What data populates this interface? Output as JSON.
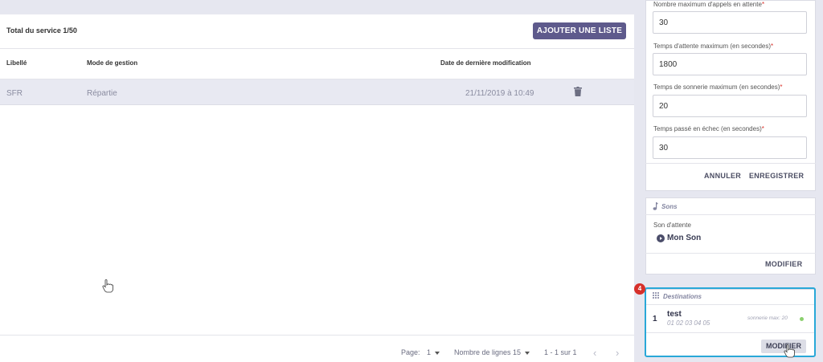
{
  "left": {
    "total_label": "Total du service 1/50",
    "add_button": "AJOUTER UNE LISTE",
    "columns": {
      "libelle": "Libellé",
      "mode": "Mode de gestion",
      "date": "Date de dernière modification"
    },
    "rows": [
      {
        "libelle": "SFR",
        "mode": "Répartie",
        "date": "21/11/2019 à 10:49"
      }
    ],
    "pager": {
      "page_label": "Page:",
      "page_value": "1",
      "lines_label": "Nombre de lignes",
      "lines_value": "15",
      "range": "1 - 1 sur 1"
    }
  },
  "settings": {
    "fields": [
      {
        "label": "Nombre maximum d'appels en attente",
        "value": "30"
      },
      {
        "label": "Temps d'attente maximum (en secondes)",
        "value": "1800"
      },
      {
        "label": "Temps de sonnerie maximum (en secondes)",
        "value": "20"
      },
      {
        "label": "Temps passé en échec (en secondes)",
        "value": "30"
      }
    ],
    "required_mark": "*",
    "cancel": "ANNULER",
    "save": "ENREGISTRER"
  },
  "sons": {
    "title": "Sons",
    "field_label": "Son d'attente",
    "value": "Mon Son",
    "modify": "MODIFIER"
  },
  "destinations": {
    "title": "Destinations",
    "badge": "4",
    "items": [
      {
        "index": "1",
        "name": "test",
        "number": "01 02 03 04 05",
        "ring": "sonnerie max: 20"
      }
    ],
    "modify": "MODIFIER"
  },
  "colors": {
    "primary": "#5e5a8c",
    "highlight": "#29a8d8",
    "badge": "#d6302a",
    "status_dot": "#8bd06e",
    "required": "#d9312a"
  },
  "icons": [
    "trash-icon",
    "music-note-icon",
    "play-icon",
    "grid-icon",
    "chevron-left-icon",
    "chevron-right-icon",
    "hand-cursor-icon"
  ]
}
